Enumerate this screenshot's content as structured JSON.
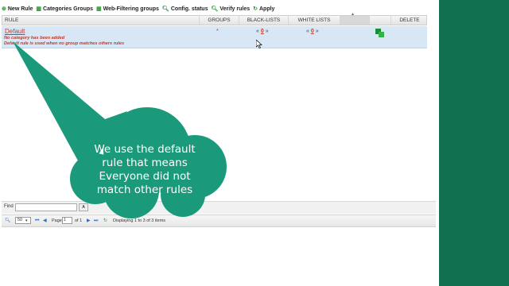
{
  "toolbar": {
    "items": [
      {
        "label": "New Rule",
        "icon": "add-icon",
        "color": "#2e9a3a"
      },
      {
        "label": "Categories Groups",
        "icon": "categories-icon",
        "color": "#2e9a3a"
      },
      {
        "label": "Web-Filtering groups",
        "icon": "filter-icon",
        "color": "#2e9a3a"
      },
      {
        "label": "Config. status",
        "icon": "search-icon",
        "color": "#2e9a3a"
      },
      {
        "label": "Verify rules",
        "icon": "search-icon",
        "color": "#2e9a3a"
      },
      {
        "label": "Apply",
        "icon": "refresh-icon",
        "color": "#2e9a3a"
      }
    ]
  },
  "grid": {
    "columns": {
      "rule": "RULE",
      "groups": "GROUPS",
      "black": "BLACK-LISTS",
      "white": "WHITE LISTS",
      "delete": "DELETE"
    },
    "row": {
      "name": "Default",
      "line1": "No category has been added",
      "line2": "Default rule is used when no group matches others rules",
      "groups": "*",
      "black_prefix": "«",
      "black_count": "0",
      "black_suffix": "»",
      "white_prefix": "«",
      "white_count": "0",
      "white_suffix": "»"
    }
  },
  "find": {
    "label": "Find",
    "value": "",
    "button": "A"
  },
  "pager": {
    "page_size": "50",
    "page_label": "Page",
    "page_value": "1",
    "of_label": "of 1",
    "status": "Displaying 1 to 3 of 3 items"
  },
  "callout": {
    "lines": [
      "We use the default",
      "rule that means",
      "Everyone did not",
      "match other rules"
    ],
    "color": "#1a9a7a"
  },
  "colors": {
    "accent_green": "#1a9a7a",
    "side_strip": "#11704f",
    "rule_red": "#c0392b",
    "row_highlight": "#d7e7f5"
  }
}
